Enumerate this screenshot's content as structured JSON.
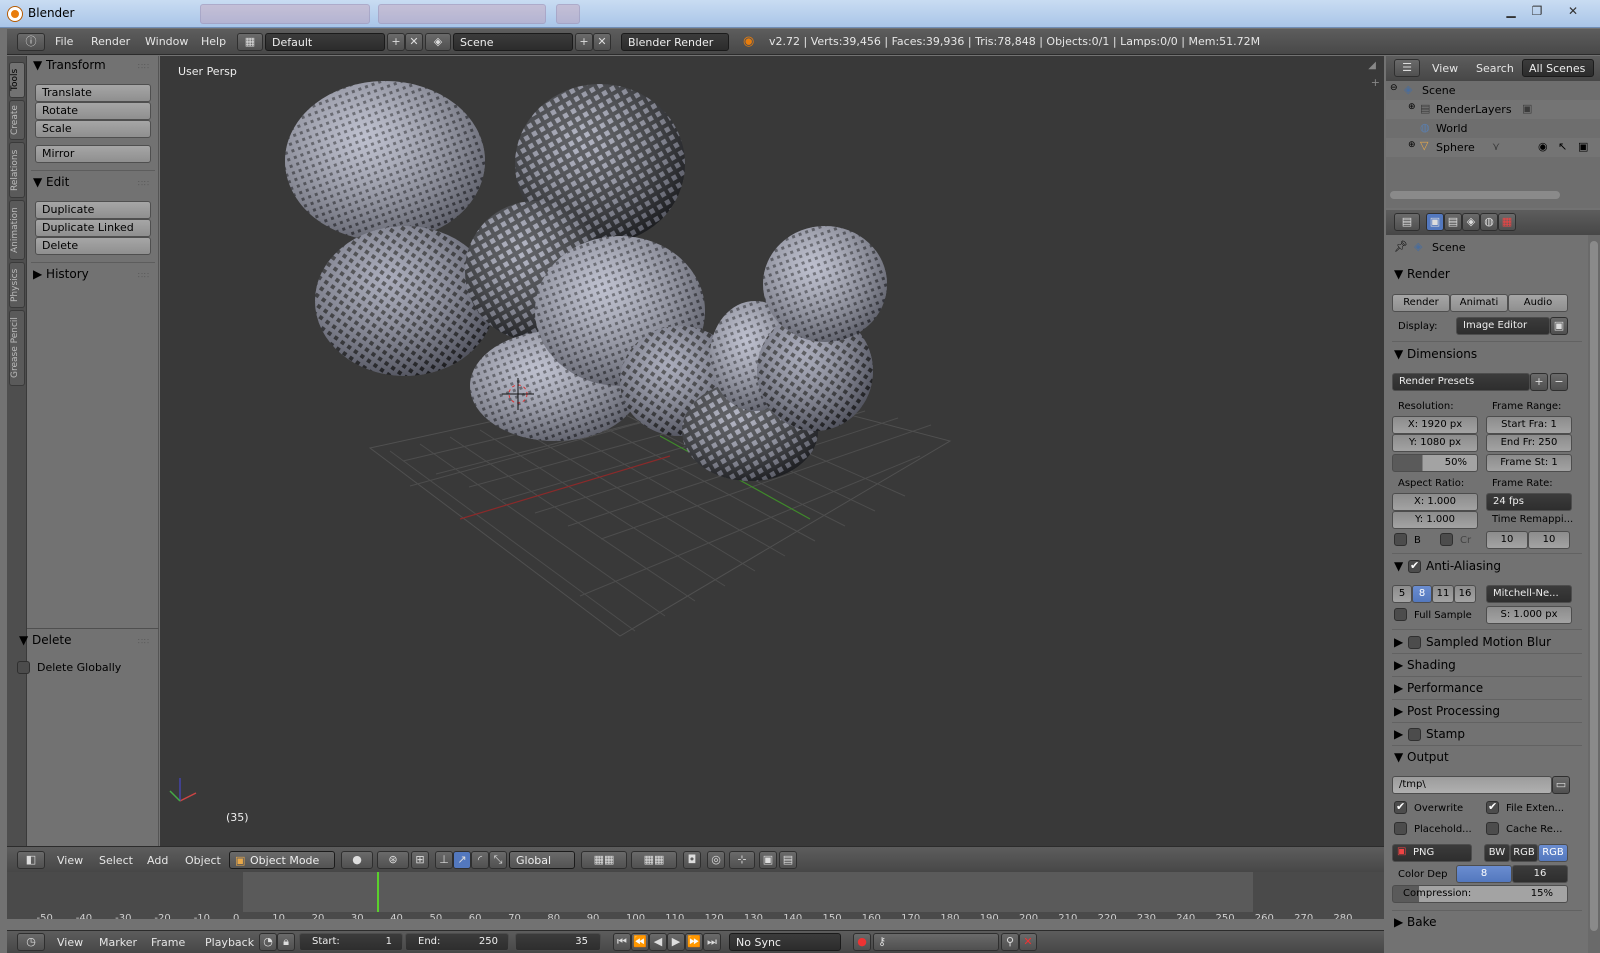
{
  "window": {
    "title": "Blender"
  },
  "info": {
    "menus": [
      "File",
      "Render",
      "Window",
      "Help"
    ],
    "layout": "Default",
    "scene": "Scene",
    "engine": "Blender Render",
    "stats": "v2.72 | Verts:39,456 | Faces:39,936 | Tris:78,848 | Objects:0/1 | Lamps:0/0 | Mem:51.72M"
  },
  "toolshelf": {
    "tabs": [
      "Tools",
      "Create",
      "Relations",
      "Animation",
      "Physics",
      "Grease Pencil"
    ],
    "transform_header": "Transform",
    "translate": "Translate",
    "rotate": "Rotate",
    "scale": "Scale",
    "mirror": "Mirror",
    "edit_header": "Edit",
    "duplicate": "Duplicate",
    "duplicate_linked": "Duplicate Linked",
    "delete": "Delete",
    "history_header": "History",
    "delete_panel_header": "Delete",
    "delete_globally": "Delete Globally"
  },
  "viewport": {
    "view_label": "User Persp",
    "frame_label": "(35)"
  },
  "view3d_header": {
    "menus": [
      "View",
      "Select",
      "Add",
      "Object"
    ],
    "mode": "Object Mode",
    "orientation": "Global"
  },
  "timeline": {
    "ticks": [
      "-50",
      "-40",
      "-30",
      "-20",
      "-10",
      "0",
      "10",
      "20",
      "30",
      "40",
      "50",
      "60",
      "70",
      "80",
      "90",
      "100",
      "110",
      "120",
      "130",
      "140",
      "150",
      "160",
      "170",
      "180",
      "190",
      "200",
      "210",
      "220",
      "230",
      "240",
      "250",
      "260",
      "270",
      "280"
    ],
    "current_frame": 35,
    "menus": [
      "View",
      "Marker",
      "Frame",
      "Playback"
    ],
    "start_label": "Start:",
    "start_value": "1",
    "end_label": "End:",
    "end_value": "250",
    "frame_value": "35",
    "sync": "No Sync"
  },
  "outliner": {
    "menus": [
      "View",
      "Search"
    ],
    "scope": "All Scenes",
    "items": [
      "Scene",
      "RenderLayers",
      "World",
      "Sphere"
    ]
  },
  "properties": {
    "context": "Scene",
    "render_header": "Render",
    "render_btn": "Render",
    "animation_btn": "Animati",
    "audio_btn": "Audio",
    "display_label": "Display:",
    "display_value": "Image Editor",
    "dimensions_header": "Dimensions",
    "render_presets": "Render Presets",
    "resolution_label": "Resolution:",
    "res_x": "X: 1920 px",
    "res_y": "Y: 1080 px",
    "res_pct": "50%",
    "frame_range_label": "Frame Range:",
    "start_frame": "Start Fra: 1",
    "end_frame": "End Fr: 250",
    "frame_step": "Frame St: 1",
    "aspect_label": "Aspect Ratio:",
    "aspect_x": "X:    1.000",
    "aspect_y": "Y:    1.000",
    "frame_rate_label": "Frame Rate:",
    "fps": "24 fps",
    "time_remap": "Time Remappi...",
    "border_label": "B",
    "crop_label": "Cr",
    "remap_old": "10",
    "remap_new": "10",
    "aa_header": "Anti-Aliasing",
    "aa_samples": [
      "5",
      "8",
      "11",
      "16"
    ],
    "aa_selected": "8",
    "aa_filter": "Mitchell-Ne...",
    "full_sample": "Full Sample",
    "aa_size": "S: 1.000 px",
    "motion_blur": "Sampled Motion Blur",
    "shading": "Shading",
    "performance": "Performance",
    "post_processing": "Post Processing",
    "stamp": "Stamp",
    "output_header": "Output",
    "output_path": "/tmp\\",
    "overwrite": "Overwrite",
    "file_ext": "File Exten...",
    "placeholders": "Placehold...",
    "cache_result": "Cache Re...",
    "format": "PNG",
    "bw": "BW",
    "rgb": "RGB",
    "rgba": "RGB",
    "color_depth_label": "Color Dep",
    "depth_8": "8",
    "depth_16": "16",
    "compression": "Compression:",
    "compression_value": "15%",
    "bake": "Bake"
  },
  "colors": {
    "accent": "#5378be",
    "timeline_cursor": "#5ad02c",
    "viewport_bg": "#393939"
  }
}
